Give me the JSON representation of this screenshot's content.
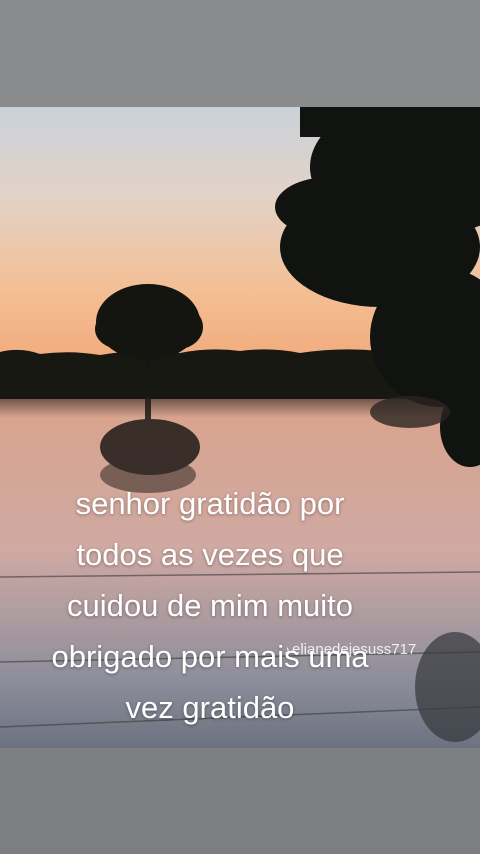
{
  "caption": {
    "line1": "senhor gratidão por",
    "line2": "todos as vezes que",
    "line3": "cuidou de mim muito",
    "line4": "obrigado por mais uma",
    "line5": "vez gratidão"
  },
  "watermark": {
    "icon": "music-note-icon",
    "handle": "elianedejesuss717"
  },
  "colors": {
    "sky_top": "#c8cfd6",
    "sky_horizon": "#f4b98c",
    "water": "#c9a59e",
    "tree_silhouette": "#141612",
    "frame": "#8a8b8d"
  }
}
